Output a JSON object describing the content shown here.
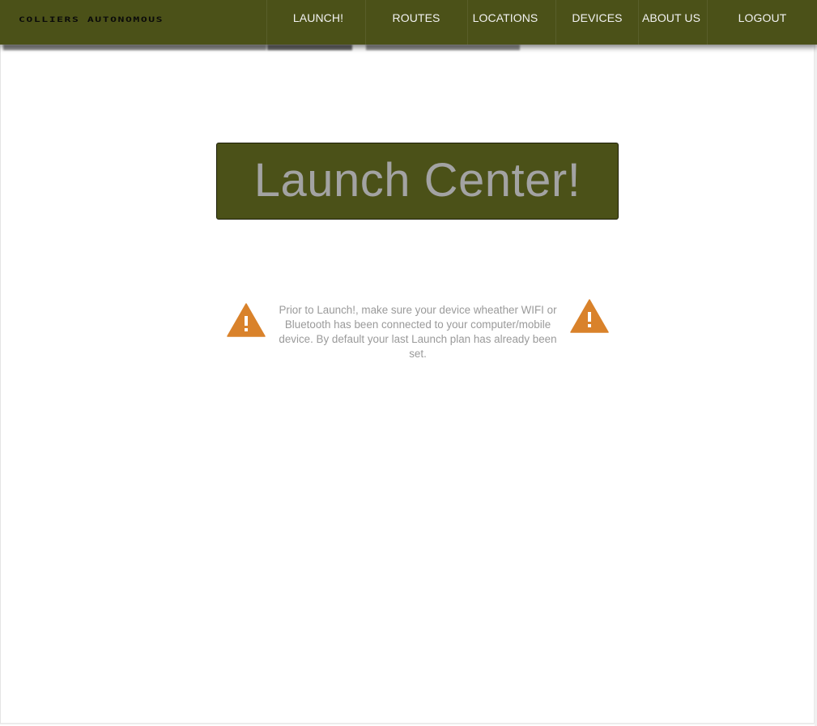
{
  "brand": {
    "name": "COLLIERS AUTONOMOUS"
  },
  "nav": {
    "items": [
      {
        "label": "LAUNCH!"
      },
      {
        "label": "ROUTES"
      },
      {
        "label": "LOCATIONS"
      },
      {
        "label": "DEVICES"
      },
      {
        "label": "ABOUT US"
      },
      {
        "label": "LOGOUT"
      }
    ]
  },
  "main": {
    "title": "Launch Center!",
    "notice": "Prior to Launch!, make sure your device wheather WIFI or Bluetooth has been connected to your computer/mobile device.  By default your last Launch plan has already been set.",
    "notice_icon": "warning-triangle-icon"
  },
  "colors": {
    "nav_background": "#4b5118",
    "banner_background": "#4b5118",
    "banner_text": "#a3a3a3",
    "warning_icon": "#d9822b",
    "notice_text": "#9a9a9a"
  }
}
